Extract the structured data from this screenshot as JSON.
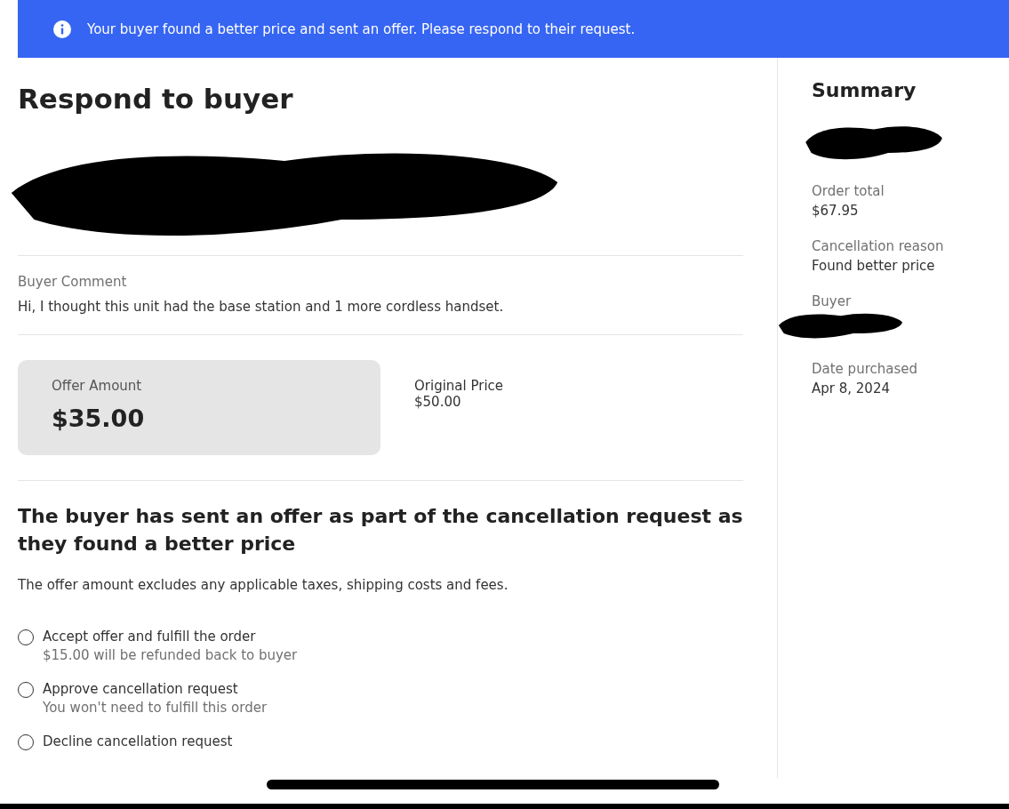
{
  "banner": {
    "message": "Your buyer found a better price and sent an offer. Please respond to their request."
  },
  "heading": "Respond to buyer",
  "item_details": {
    "kind": "redacted"
  },
  "buyer_comment": {
    "label": "Buyer Comment",
    "text": "Hi, I thought this unit had the base station and 1 more cordless handset."
  },
  "offer": {
    "label": "Offer Amount",
    "amount": "$35.00"
  },
  "original_price": {
    "label": "Original Price",
    "value": "$50.00"
  },
  "section_title": "The buyer has sent an offer as part of the cancellation request as they found a better price",
  "note": "The offer amount excludes any applicable taxes, shipping costs and fees.",
  "options": [
    {
      "label": "Accept offer and fulfill the order",
      "sublabel": "$15.00 will be refunded back to buyer",
      "selected": false
    },
    {
      "label": "Approve cancellation request",
      "sublabel": "You won't need to fulfill this order",
      "selected": false
    },
    {
      "label": "Decline cancellation request",
      "selected": false
    }
  ],
  "summary": {
    "title": "Summary",
    "items": [
      {
        "kind": "redacted"
      },
      {
        "kind": "field",
        "label": "Order total",
        "value": "$67.95"
      },
      {
        "kind": "field",
        "label": "Cancellation reason",
        "value": "Found better price"
      },
      {
        "kind": "redacted",
        "label": "Buyer"
      },
      {
        "kind": "field",
        "label": "Date purchased",
        "value": "Apr 8, 2024"
      }
    ]
  }
}
